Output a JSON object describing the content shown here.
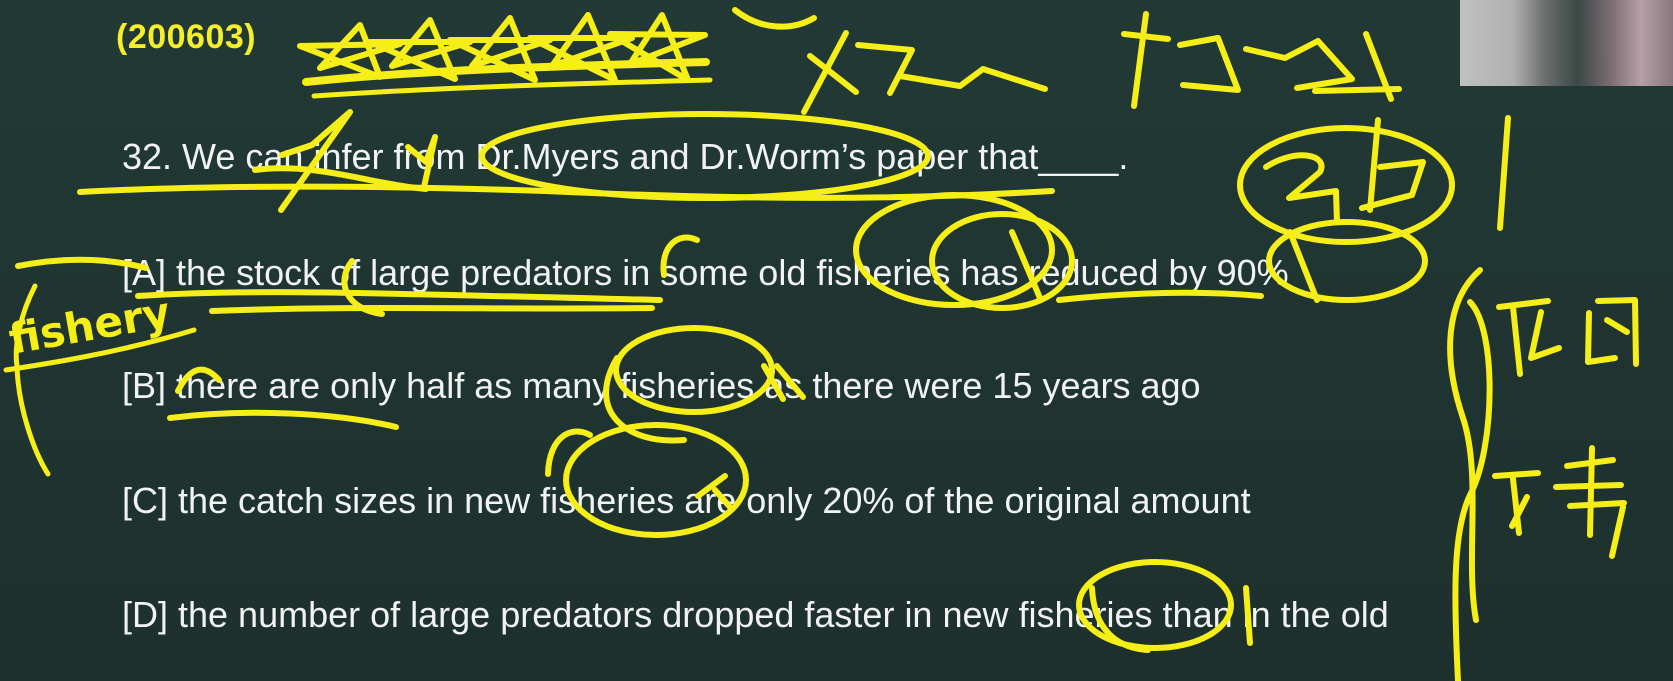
{
  "exam_code": "(200603)",
  "question": "32. We can infer from Dr.Myers and Dr.Worm’s paper that____.",
  "options": [
    "[A] the stock of large predators in some old fisheries has reduced by 90%",
    "[B] there are only half as many fisheries as there were 15 years ago",
    "[C] the catch sizes in new fisheries are only 20% of the original amount",
    "[D] the number of large predators dropped faster in new fisheries than in the old"
  ],
  "handwriting": {
    "fishery": "fishery"
  }
}
